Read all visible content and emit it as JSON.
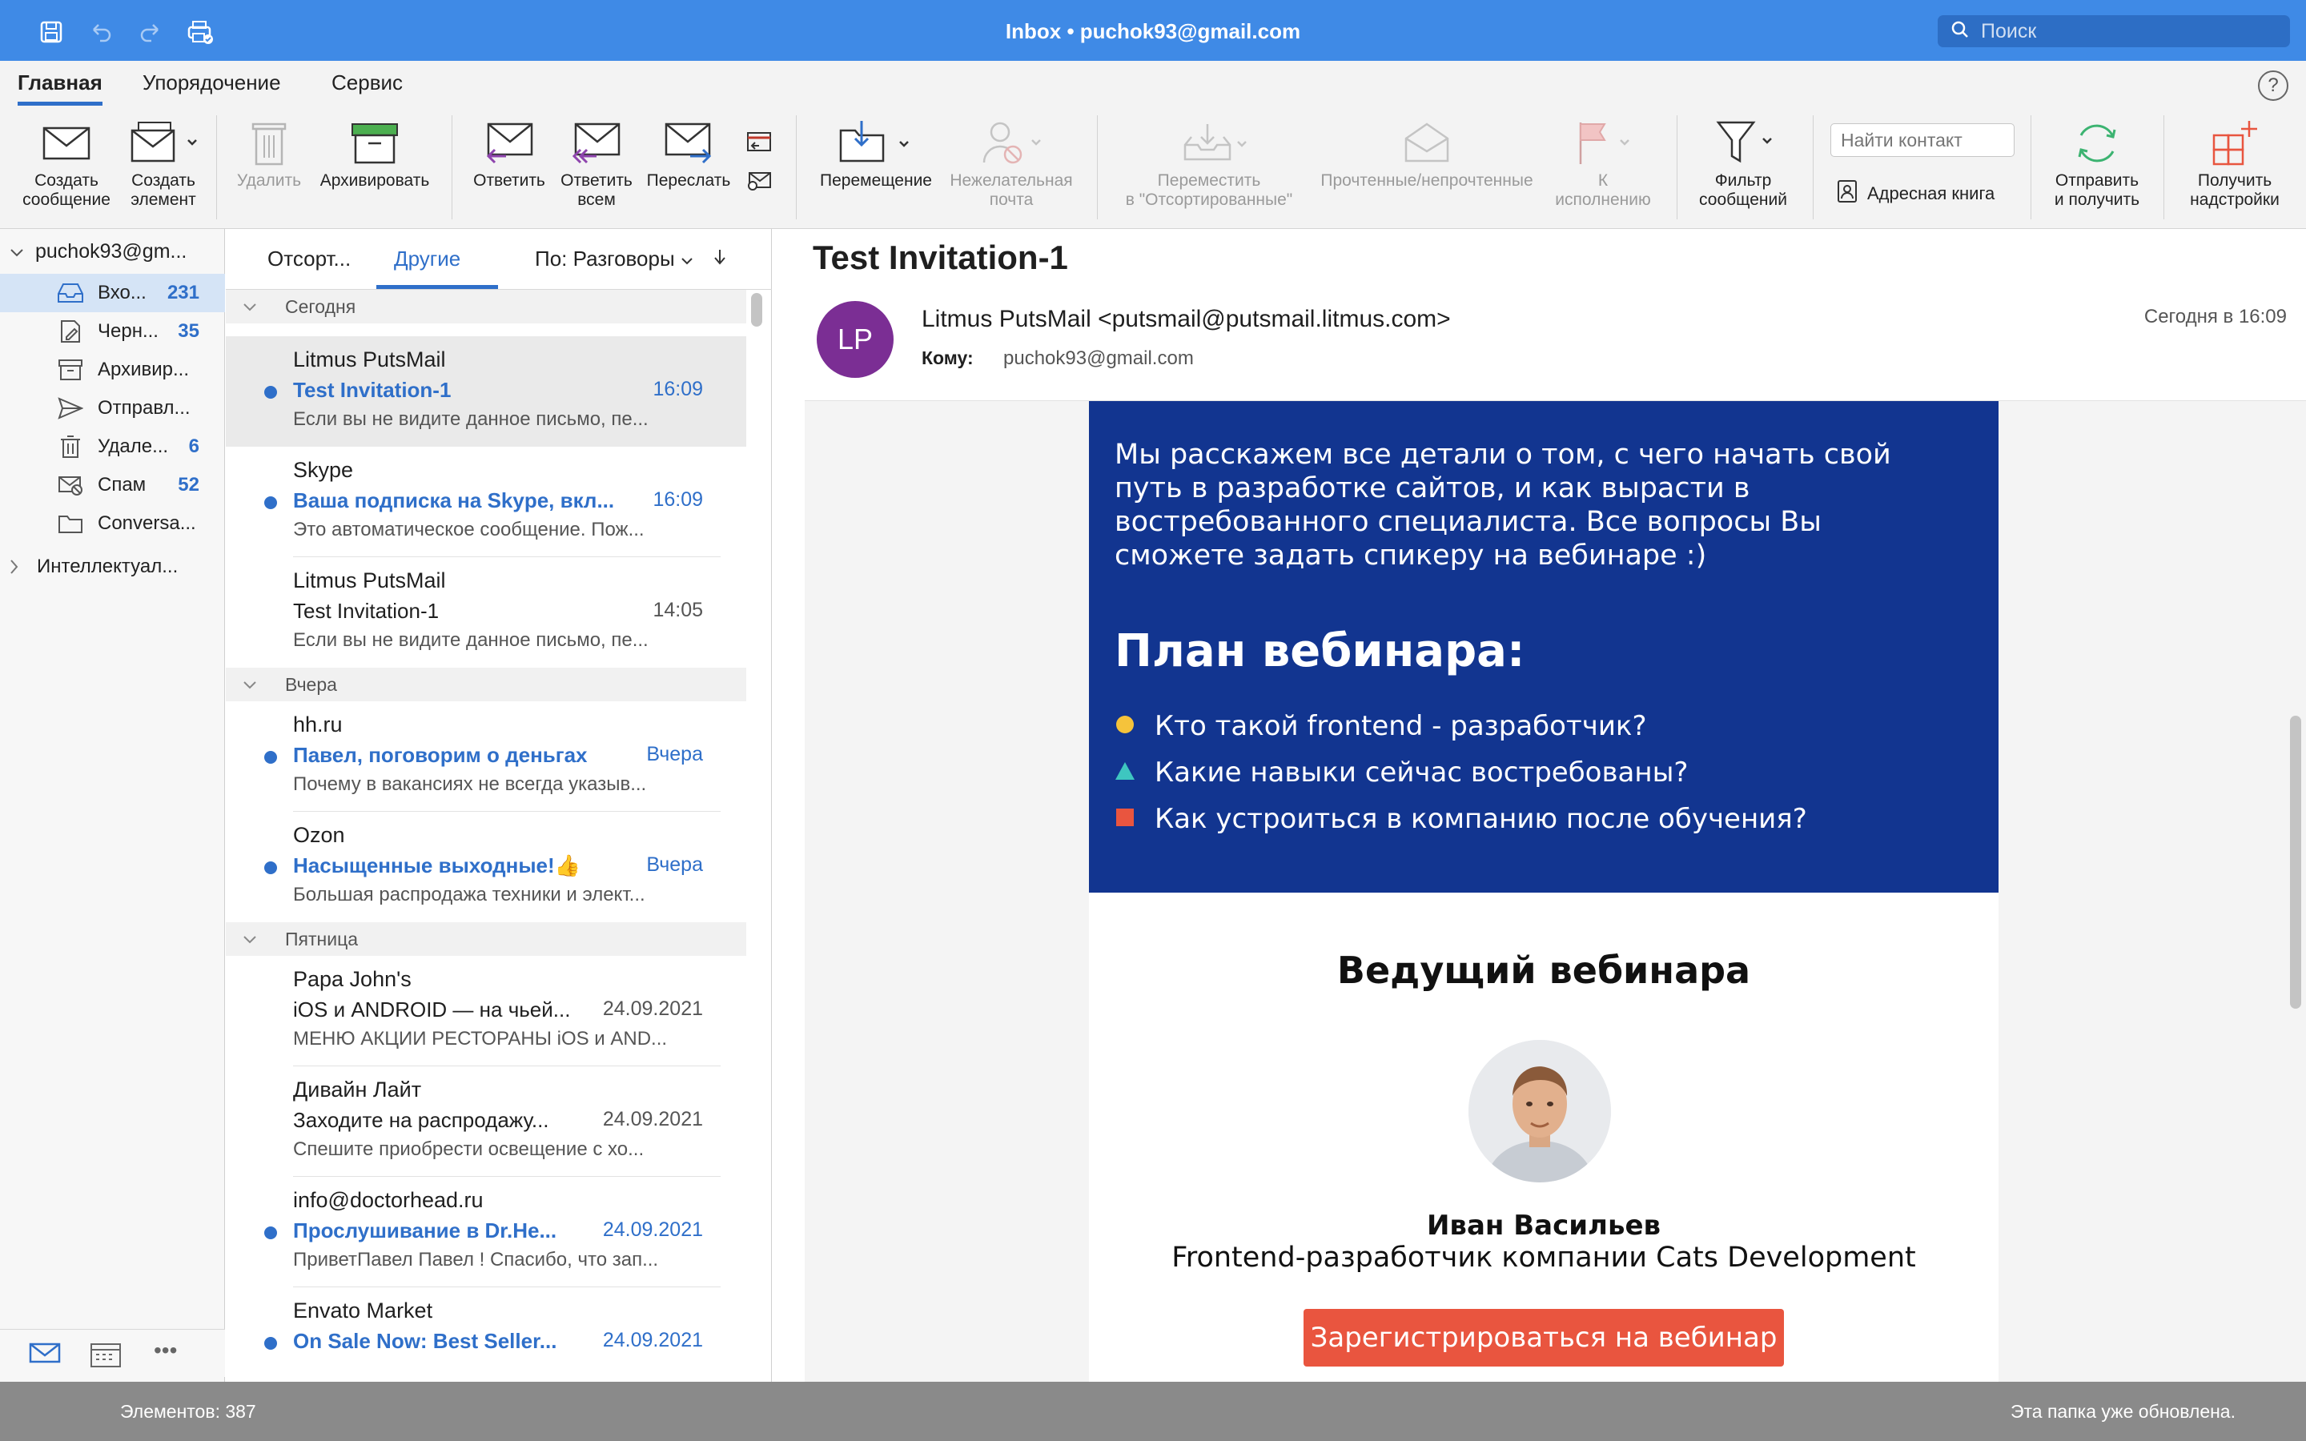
{
  "window": {
    "title": "Inbox • puchok93@gmail.com"
  },
  "search": {
    "placeholder": "Поиск"
  },
  "ribbon_tabs": [
    "Главная",
    "Упорядочение",
    "Сервис"
  ],
  "ribbon": {
    "new_message": [
      "Создать",
      "сообщение"
    ],
    "new_item": [
      "Создать",
      "элемент"
    ],
    "delete": "Удалить",
    "archive": "Архивировать",
    "reply": "Ответить",
    "reply_all": [
      "Ответить",
      "всем"
    ],
    "forward": "Переслать",
    "move": "Перемещение",
    "junk": [
      "Нежелательная",
      "почта"
    ],
    "move_focused": [
      "Переместить",
      "в \"Отсортированные\""
    ],
    "read_unread": "Прочтенные/непрочтенные",
    "followup": [
      "К",
      "исполнению"
    ],
    "filter": [
      "Фильтр",
      "сообщений"
    ],
    "find_contact_placeholder": "Найти контакт",
    "address_book": "Адресная книга",
    "send_receive": [
      "Отправить",
      "и получить"
    ],
    "addins": [
      "Получить",
      "надстройки"
    ]
  },
  "folders": {
    "account": "puchok93@gm...",
    "items": [
      {
        "label": "Вхо...",
        "count": "231",
        "icon": "inbox-icon"
      },
      {
        "label": "Черн...",
        "count": "35",
        "icon": "drafts-icon"
      },
      {
        "label": "Архивир...",
        "count": "",
        "icon": "archive-icon"
      },
      {
        "label": "Отправл...",
        "count": "",
        "icon": "sent-icon"
      },
      {
        "label": "Удале...",
        "count": "6",
        "icon": "trash-icon"
      },
      {
        "label": "Спам",
        "count": "52",
        "icon": "junk-icon"
      },
      {
        "label": "Conversa...",
        "count": "",
        "icon": "folder-icon"
      }
    ],
    "group": "Интеллектуал..."
  },
  "list": {
    "tab_focused": "Отсорт...",
    "tab_other": "Другие",
    "sort": "По: Разговоры",
    "groups": [
      "Сегодня",
      "Вчера",
      "Пятница"
    ],
    "messages": [
      {
        "sender": "Litmus PutsMail",
        "subject": "Test Invitation-1",
        "time": "16:09",
        "preview": "Если вы не видите данное письмо, пе...",
        "unread": true
      },
      {
        "sender": "Skype",
        "subject": "Ваша подписка на Skype, вкл...",
        "time": "16:09",
        "preview": "Это автоматическое сообщение. Пож...",
        "unread": true
      },
      {
        "sender": "Litmus PutsMail",
        "subject": "Test Invitation-1",
        "time": "14:05",
        "preview": "Если вы не видите данное письмо, пе...",
        "unread": false
      },
      {
        "sender": "hh.ru",
        "subject": "Павел, поговорим о деньгах",
        "time": "Вчера",
        "preview": "Почему в вакансиях не всегда указыв...",
        "unread": true
      },
      {
        "sender": "Ozon",
        "subject": "Насыщенные выходные!👍",
        "time": "Вчера",
        "preview": "Большая распродажа техники и элект...",
        "unread": true
      },
      {
        "sender": "Papa John's",
        "subject": "iOS и ANDROID — на чьей...",
        "time": "24.09.2021",
        "preview": "МЕНЮ АКЦИИ РЕСТОРАНЫ iOS и AND...",
        "unread": false
      },
      {
        "sender": "Дивайн Лайт",
        "subject": "Заходите на распродажу...",
        "time": "24.09.2021",
        "preview": "Спешите приобрести освещение с хо...",
        "unread": false
      },
      {
        "sender": "info@doctorhead.ru",
        "subject": "Прослушивание в Dr.He...",
        "time": "24.09.2021",
        "preview": "ПриветПавел Павел ! Спасибо, что зап...",
        "unread": true
      },
      {
        "sender": "Envato Market",
        "subject": "On Sale Now: Best Seller...",
        "time": "24.09.2021",
        "preview": "",
        "unread": true
      }
    ]
  },
  "reader": {
    "subject": "Test Invitation-1",
    "avatar_initials": "LP",
    "from": "Litmus PutsMail <putsmail@putsmail.litmus.com>",
    "to_label": "Кому:",
    "to": "puchok93@gmail.com",
    "date": "Сегодня в 16:09",
    "body": {
      "intro": "Мы расскажем все детали о том, с чего начать свой путь в разработке сайтов, и как вырасти в востребованного специалиста. Все вопросы Вы сможете задать спикеру на вебинаре :)",
      "plan_title": "План вебинара:",
      "bullets": [
        {
          "text": "Кто такой frontend - разработчик?",
          "color": "#f5c33b",
          "shape": "circle"
        },
        {
          "text": "Какие навыки сейчас востребованы?",
          "color": "#3ec6c0",
          "shape": "triangle"
        },
        {
          "text": "Как устроиться в компанию после обучения?",
          "color": "#e9553f",
          "shape": "square"
        }
      ],
      "host_title": "Ведущий вебинара",
      "host_name": "Иван Васильев",
      "host_role": "Frontend-разработчик компании Cats Development",
      "cta": "Зарегистрироваться на вебинар"
    }
  },
  "status": {
    "count": "Элементов: 387",
    "state": "Эта папка уже обновлена."
  },
  "colors": {
    "titlebar": "#3f8ae6",
    "accent": "#2f6fc9",
    "email_blue": "#123590",
    "cta": "#e9553f",
    "avatar": "#7b2e94"
  }
}
